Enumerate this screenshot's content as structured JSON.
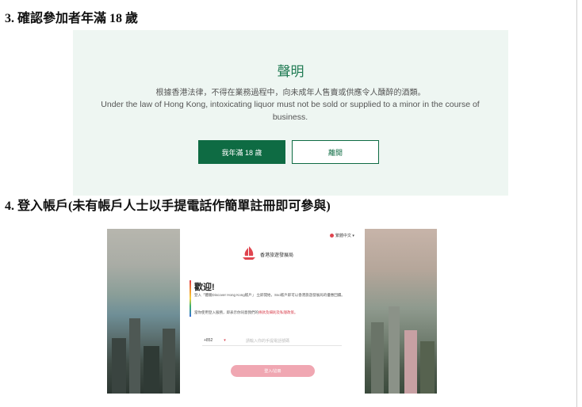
{
  "sections": [
    {
      "heading": "3. 確認參加者年滿 18 歲"
    },
    {
      "heading": "4. 登入帳戶(未有帳戶人士以手提電話作簡單註冊即可參與)"
    }
  ],
  "disclaimer": {
    "title": "聲明",
    "text_zh": "根據香港法律，不得在業務過程中，向未成年人售賣或供應令人醺醉的酒類。",
    "text_en": "Under the law of Hong Kong, intoxicating liquor must not be sold or supplied to a minor in the course of business.",
    "confirm_label": "我年滿 18 歲",
    "leave_label": "離開",
    "colors": {
      "background": "#eef6f2",
      "accent": "#0e6b43"
    }
  },
  "login": {
    "language": "繁體中文",
    "org_name": "香港旅遊發展局",
    "welcome": "歡迎!",
    "intro_text": "登入「體驗Discover Hong Kong帳戶」 立即開始，Sso帳戶即可以香港旅遊發展局的優惠回饋。",
    "terms_prefix": "當你使用登入服務，即表示你同意我們的",
    "terms_link": "條款及細則及私隱政策。",
    "country_code": "+852",
    "phone_placeholder": "請輸入你的手提電話號碼",
    "login_button": "登入/註冊",
    "colors": {
      "brand": "#e0454f",
      "button": "#f0a7b2"
    }
  }
}
